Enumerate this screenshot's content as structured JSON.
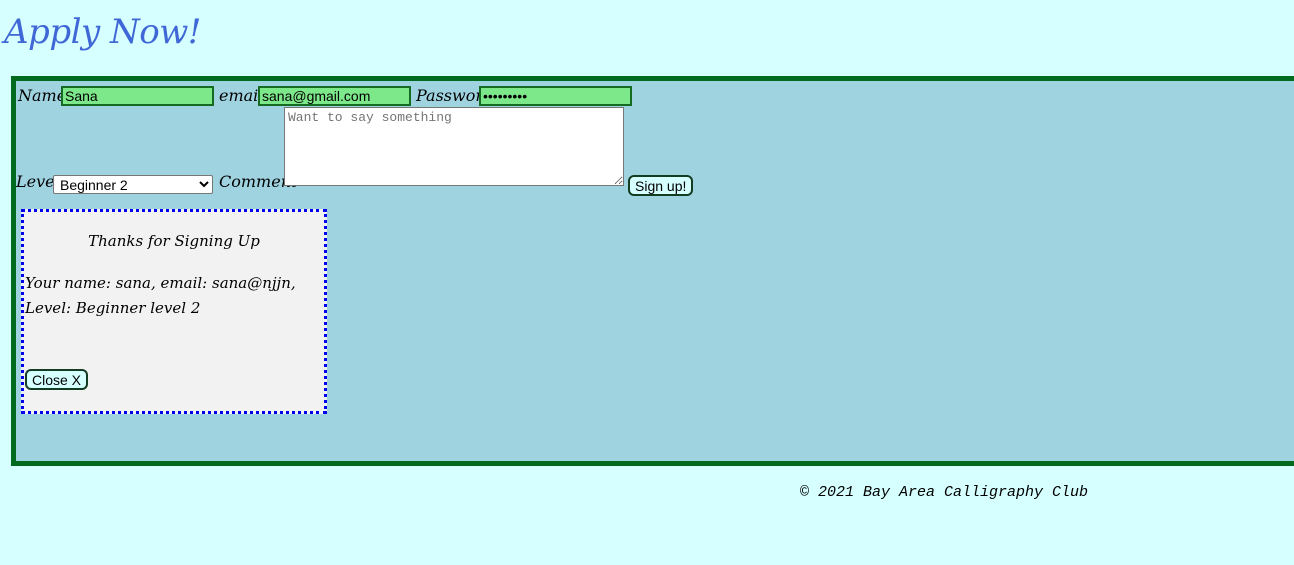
{
  "page": {
    "title": "Apply Now!"
  },
  "form": {
    "name_label": "Name",
    "name_value": "Sana",
    "email_label": "email",
    "email_value": "sana@gmail.com",
    "password_label": "Password",
    "password_value": "•••••••••",
    "level_label": "Level",
    "level_selected": "Beginner 2",
    "comment_label": "Comment",
    "comment_placeholder": "Want to say something",
    "submit_label": "Sign up!"
  },
  "modal": {
    "title": "Thanks for Signing Up",
    "message": "Your name: sana, email: sana@njjn, Level: Beginner level 2",
    "close_label": "Close X"
  },
  "footer": {
    "text": "© 2021 Bay Area Calligraphy Club"
  },
  "colors": {
    "background": "#d6ffff",
    "panel": "#9fd3e0",
    "panel_border": "#006b1e",
    "input_fill": "#7de88a",
    "title": "#3f67d6",
    "modal_border": "#0000ee"
  }
}
